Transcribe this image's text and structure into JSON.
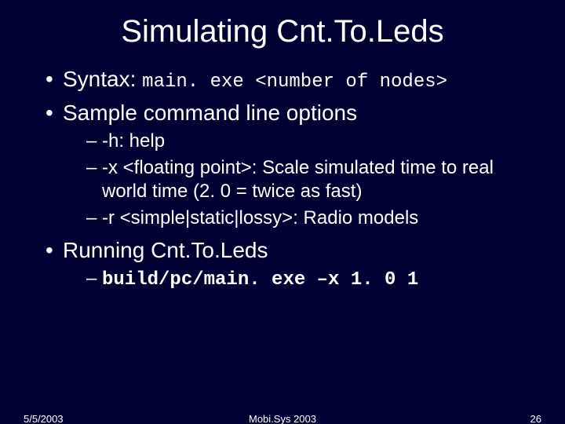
{
  "title": "Simulating Cnt.To.Leds",
  "bullets": {
    "syntax_label": "Syntax:",
    "syntax_cmd": "main. exe <number of nodes>",
    "sample_label": "Sample command line options",
    "sub": {
      "help": "-h: help",
      "scale": "-x <floating point>: Scale simulated time to real world time (2. 0 = twice as fast)",
      "radio": "-r <simple|static|lossy>: Radio models"
    },
    "running_label": "Running Cnt.To.Leds",
    "running_cmd": "build/pc/main. exe –x 1. 0 1"
  },
  "footer": {
    "date": "5/5/2003",
    "venue": "Mobi.Sys 2003",
    "page": "26"
  }
}
